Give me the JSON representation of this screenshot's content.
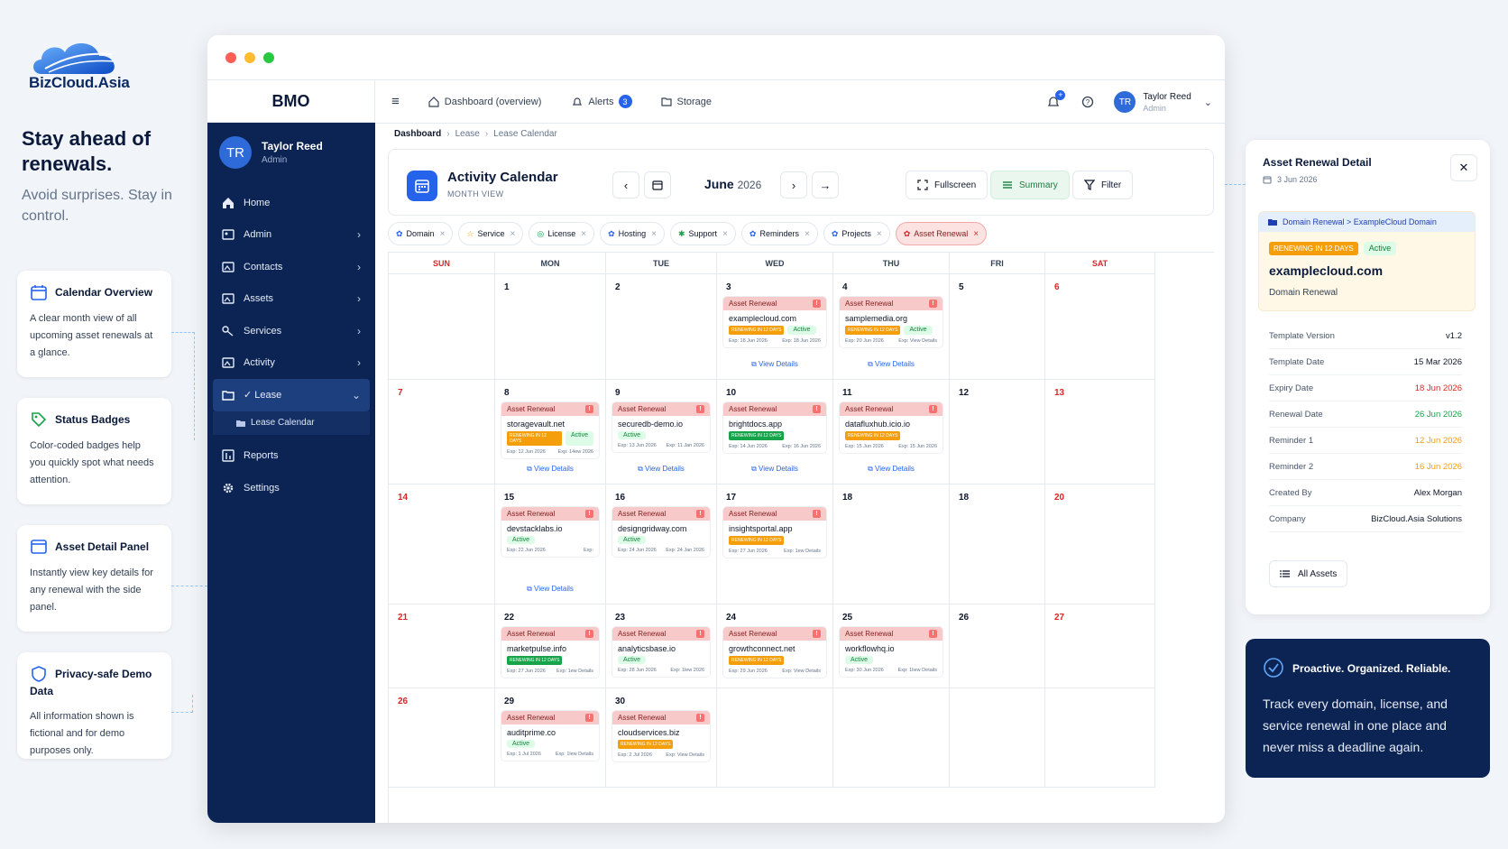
{
  "brand": {
    "name": "BizCloud.Asia"
  },
  "hero": {
    "headline": "Stay ahead of renewals.",
    "subline": "Avoid surprises. Stay in control."
  },
  "features": [
    {
      "title": "Calendar Overview",
      "desc": "A clear month view of all upcoming asset renewals at a glance."
    },
    {
      "title": "Status Badges",
      "desc": "Color-coded badges help you quickly spot what needs attention."
    },
    {
      "title": "Asset Detail Panel",
      "desc": "Instantly view key details for any renewal with the side panel."
    },
    {
      "title": "Privacy-safe Demo Data",
      "desc": "All information shown is fictional and for demo purposes only."
    }
  ],
  "app": {
    "name": "BMO",
    "user": {
      "initials": "TR",
      "name": "Taylor Reed",
      "role": "Admin"
    },
    "sidebar": {
      "items": [
        {
          "label": "Home"
        },
        {
          "label": "Admin"
        },
        {
          "label": "Contacts"
        },
        {
          "label": "Assets"
        },
        {
          "label": "Services"
        },
        {
          "label": "Activity"
        },
        {
          "label": "Lease"
        },
        {
          "label": "Reports"
        },
        {
          "label": "Settings"
        }
      ],
      "sub_label": "Lease Calendar"
    },
    "topbar": {
      "dashboard": "Dashboard (overview)",
      "alerts": "Alerts",
      "alerts_count": "3",
      "storage": "Storage",
      "notif_count": "+"
    },
    "breadcrumb": [
      "Dashboard",
      "Lease",
      "Lease Calendar"
    ],
    "calendar": {
      "title": "Activity Calendar",
      "view": "MONTH VIEW",
      "month": "June",
      "year": "2026",
      "buttons": {
        "fullscreen": "Fullscreen",
        "summary": "Summary",
        "filter": "Filter"
      },
      "filters": [
        "Domain",
        "Service",
        "License",
        "Hosting",
        "Support",
        "Reminders",
        "Projects",
        "Asset Renewal"
      ],
      "days": [
        "SUN",
        "MON",
        "TUE",
        "WED",
        "THU",
        "FRI",
        "SAT"
      ],
      "event_label": "Asset Renewal",
      "view_details": "View Details",
      "active_label": "Active",
      "renew_label": "RENEWING IN 12 DAYS",
      "weeks": [
        [
          {
            "d": ""
          },
          {
            "d": "1"
          },
          {
            "d": "2"
          },
          {
            "d": "3",
            "dom": "examplecloud.com",
            "renew": true,
            "active": true,
            "exp": "Exp: 18 Jun 2026",
            "exp2": "Exp: 18 Jun 2026",
            "link": true
          },
          {
            "d": "4",
            "dom": "samplemedia.org",
            "renew": true,
            "active": true,
            "exp": "Exp: 20 Jun 2026",
            "exp2": "Exp: View Details",
            "link": true
          },
          {
            "d": "5"
          },
          {
            "d": "6"
          }
        ],
        [
          {
            "d": "7"
          },
          {
            "d": "8",
            "dom": "storagevault.net",
            "renew": true,
            "active": true,
            "exp": "Exp: 12 Jun 2026",
            "exp2": "Exp: 14ew 2026",
            "link": true
          },
          {
            "d": "9",
            "dom": "securedb-demo.io",
            "active": true,
            "exp": "Exp: 13 Jun 2026",
            "exp2": "Exp: 11 Jan 2026",
            "link": true
          },
          {
            "d": "10",
            "dom": "brightdocs.app",
            "renew": true,
            "green": true,
            "exp": "Exp: 14 Jun 2026",
            "exp2": "Exp: 16 Jun 2026",
            "link": true
          },
          {
            "d": "11",
            "dom": "datafluxhub.icio.io",
            "renew": true,
            "exp": "Exp: 15 Jun 2026",
            "exp2": "Exp: 15 Jun 2026",
            "link": true
          },
          {
            "d": "12"
          },
          {
            "d": "13"
          }
        ],
        [
          {
            "d": "14"
          },
          {
            "d": "15",
            "dom": "devstacklabs.io",
            "active": true,
            "exp": "Exp: 22 Jun 2026",
            "exp2": "Exp:",
            "link": true
          },
          {
            "d": "16",
            "dom": "designgridway.com",
            "active": true,
            "exp": "Exp: 24 Jun 2026",
            "exp2": "Exp: 24 Jan 2026"
          },
          {
            "d": "17",
            "dom": "insightsportal.app",
            "renew": true,
            "exp": "Exp: 27 Jun 2026",
            "exp2": "Exp: 1ew Details"
          },
          {
            "d": "18"
          },
          {
            "d": "18"
          },
          {
            "d": "20"
          }
        ],
        [
          {
            "d": "21"
          },
          {
            "d": "22",
            "dom": "marketpulse.info",
            "renew": true,
            "green": true,
            "exp": "Exp: 27 Jun 2026",
            "exp2": "Exp: 1ew Details"
          },
          {
            "d": "23",
            "dom": "analyticsbase.io",
            "active": true,
            "exp": "Exp: 28 Jun 2026",
            "exp2": "Exp: 1lew 2026"
          },
          {
            "d": "24",
            "dom": "growthconnect.net",
            "renew": true,
            "exp": "Exp: 29 Jun 2026",
            "exp2": "Exp: View Details"
          },
          {
            "d": "25",
            "dom": "workflowhq.io",
            "active": true,
            "exp": "Exp: 30 Jun 2026",
            "exp2": "Exp: 1liew Details"
          },
          {
            "d": "26"
          },
          {
            "d": "27"
          }
        ],
        [
          {
            "d": "26"
          },
          {
            "d": "29",
            "dom": "auditprime.co",
            "active": true,
            "exp": "Exp: 1 Jul 2026",
            "exp2": "Exp: 1lew Details"
          },
          {
            "d": "30",
            "dom": "cloudservices.biz",
            "renew": true,
            "exp": "Exp: 2 Jul 2026",
            "exp2": "Exp: View Details"
          },
          {
            "d": ""
          },
          {
            "d": ""
          },
          {
            "d": ""
          },
          {
            "d": ""
          }
        ]
      ]
    }
  },
  "panel": {
    "title": "Asset Renewal Detail",
    "date": "3 Jun 2026",
    "card_head": "Domain Renewal > ExampleCloud Domain",
    "renew_tag": "RENEWING IN 12 DAYS",
    "active_tag": "Active",
    "domain": "examplecloud.com",
    "type": "Domain Renewal",
    "rows": [
      {
        "k": "Template Version",
        "v": "v1.2",
        "color": "#0f172a"
      },
      {
        "k": "Template Date",
        "v": "15 Mar 2026",
        "color": "#0f172a"
      },
      {
        "k": "Expiry Date",
        "v": "18 Jun 2026",
        "color": "#dc2626"
      },
      {
        "k": "Renewal Date",
        "v": "26 Jun 2026",
        "color": "#16a34a"
      },
      {
        "k": "Reminder 1",
        "v": "12 Jun 2026",
        "color": "#f59e0b"
      },
      {
        "k": "Reminder 2",
        "v": "16 Jun 2026",
        "color": "#f59e0b"
      },
      {
        "k": "Created By",
        "v": "Alex Morgan",
        "color": "#0f172a"
      },
      {
        "k": "Company",
        "v": "BizCloud.Asia Solutions",
        "color": "#0f172a"
      }
    ],
    "all_assets": "All Assets"
  },
  "promo": {
    "title": "Proactive. Organized. Reliable.",
    "text": "Track every domain, license, and service renewal in one place and never miss a deadline again."
  },
  "colors": {
    "navy": "#0c2454",
    "accent": "#2563eb",
    "danger": "#dc2626",
    "success": "#16a34a",
    "warning": "#f59e0b"
  }
}
